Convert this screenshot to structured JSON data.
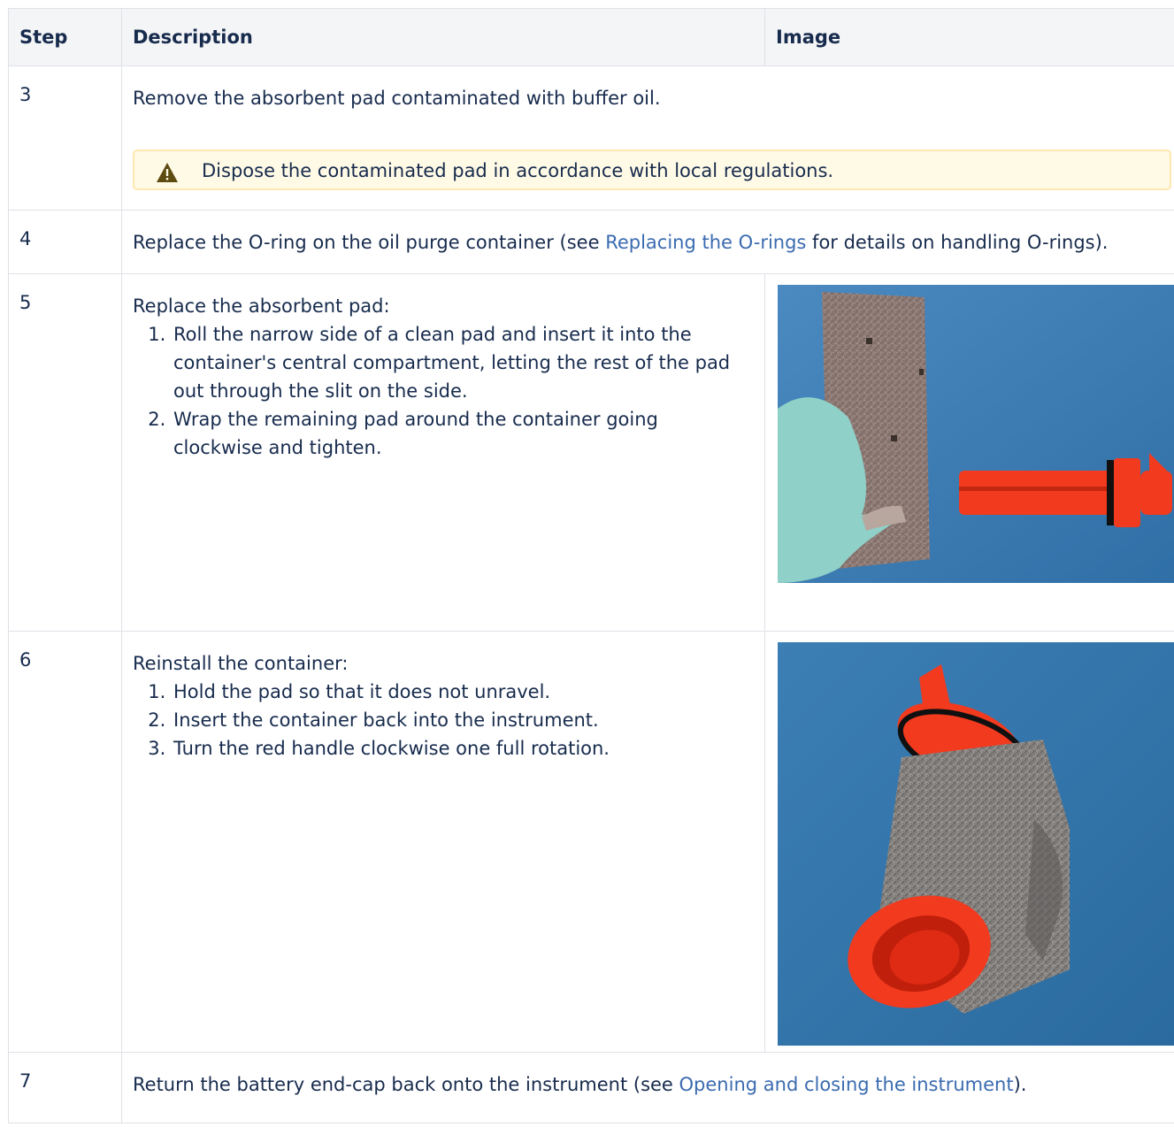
{
  "table": {
    "headers": {
      "step": "Step",
      "description": "Description",
      "image": "Image"
    }
  },
  "rows": {
    "r3": {
      "step": "3",
      "text": "Remove the absorbent pad contaminated with buffer oil.",
      "warning": "Dispose the contaminated pad in accordance with local regulations."
    },
    "r4": {
      "step": "4",
      "text_before": "Replace the O-ring on the oil purge container (see ",
      "link": "Replacing the O-rings",
      "text_after": " for details on handling O-rings)."
    },
    "r5": {
      "step": "5",
      "intro": "Replace the absorbent pad:",
      "items": [
        "Roll the narrow side of a clean pad and insert it into the container's central compartment, letting the rest of the pad out through the slit on the side.",
        "Wrap the remaining pad around the container going clockwise and tighten."
      ]
    },
    "r6": {
      "step": "6",
      "intro": "Reinstall the container:",
      "items": [
        "Hold the pad so that it does not unravel.",
        "Insert the container back into the instrument.",
        "Turn the red handle clockwise one full rotation."
      ]
    },
    "r7": {
      "step": "7",
      "text_before": "Return the battery end-cap back onto the instrument (see ",
      "link": "Opening and closing the instrument",
      "text_after": ")."
    }
  },
  "colors": {
    "link": "#3a6bb0",
    "warning_bg": "#fffae6",
    "warning_icon": "#5e4b10",
    "photo_bg": "#3c7fb5",
    "container_red": "#f23a1e"
  },
  "icons": {
    "warning": "warning-icon"
  }
}
